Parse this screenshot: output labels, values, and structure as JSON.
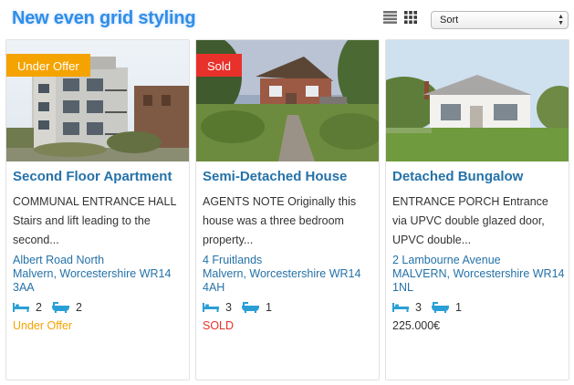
{
  "header": {
    "title": "New even grid styling",
    "sort": {
      "selected": "Sort"
    }
  },
  "colors": {
    "title": "#2f8ee8",
    "link": "#2572a8",
    "under_offer": "#f5a300",
    "sold": "#e8312a",
    "icon": "#2a9fd6"
  },
  "listings": [
    {
      "tag": "Under Offer",
      "title": "Second Floor Apartment",
      "description": "COMMUNAL ENTRANCE HALL Stairs and lift leading to the second...",
      "address_line1": "Albert Road North",
      "address_line2": "Malvern, Worcestershire WR14 3AA",
      "bedrooms": "2",
      "bathrooms": "2",
      "status": "Under Offer"
    },
    {
      "tag": "Sold",
      "title": "Semi-Detached House",
      "description": "AGENTS NOTE Originally this house was a three bedroom property...",
      "address_line1": "4 Fruitlands",
      "address_line2": "Malvern, Worcestershire WR14 4AH",
      "bedrooms": "3",
      "bathrooms": "1",
      "status": "SOLD"
    },
    {
      "tag": "",
      "title": "Detached Bungalow",
      "description": "ENTRANCE PORCH Entrance via UPVC double glazed door, UPVC double...",
      "address_line1": "2 Lambourne Avenue",
      "address_line2": "MALVERN, Worcestershire WR14 1NL",
      "bedrooms": "3",
      "bathrooms": "1",
      "status": "225.000€"
    }
  ],
  "icons": {
    "list_view": "list-view-icon",
    "grid_view": "grid-view-icon",
    "bed": "bed-icon",
    "bath": "bathtub-icon",
    "sort_arrows": "up-down-arrows-icon"
  }
}
